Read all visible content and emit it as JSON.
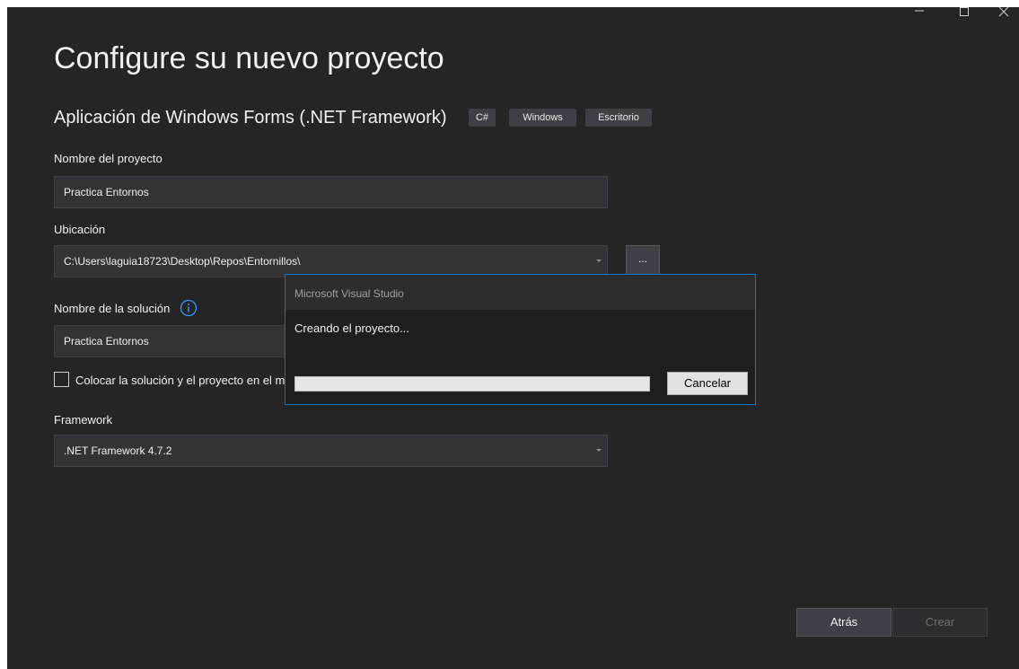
{
  "title": "Configure su nuevo proyecto",
  "template": {
    "name": "Aplicación de Windows Forms (.NET Framework)",
    "tags": [
      "C#",
      "Windows",
      "Escritorio"
    ]
  },
  "fields": {
    "project_name": {
      "label": "Nombre del proyecto",
      "value": "Practica Entornos"
    },
    "location": {
      "label": "Ubicación",
      "value": "C:\\Users\\laguia18723\\Desktop\\Repos\\Entornillos\\",
      "browse_label": "..."
    },
    "solution_name": {
      "label": "Nombre de la solución",
      "value": "Practica Entornos"
    },
    "same_dir_checkbox": {
      "label": "Colocar la solución y el proyecto en el m",
      "checked": false
    },
    "framework": {
      "label": "Framework",
      "value": ".NET Framework 4.7.2"
    }
  },
  "buttons": {
    "back": "Atrás",
    "create": "Crear"
  },
  "dialog": {
    "title": "Microsoft Visual Studio",
    "message": "Creando el proyecto...",
    "progress": 0,
    "cancel": "Cancelar"
  },
  "colors": {
    "background": "#252526",
    "field": "#333337",
    "accent": "#007acc",
    "tag": "#3f3f46"
  },
  "icons": [
    "minimize-icon",
    "maximize-icon",
    "close-icon",
    "info-icon",
    "dropdown-caret-icon"
  ]
}
